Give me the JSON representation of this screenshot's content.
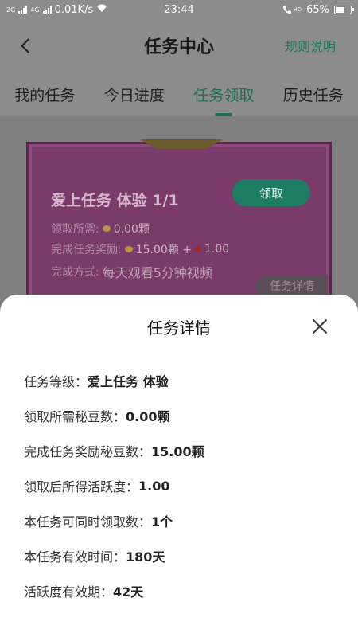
{
  "status_bar": {
    "network_left": "2G",
    "network_right": "4G",
    "speed": "0.01K/s",
    "time": "23:44",
    "call_badge": "HD",
    "battery": "65%",
    "battery_level": 0.65
  },
  "header": {
    "title": "任务中心",
    "rules_link": "规则说明"
  },
  "tabs": [
    {
      "label": "我的任务",
      "active": false
    },
    {
      "label": "今日进度",
      "active": false
    },
    {
      "label": "任务领取",
      "active": true
    },
    {
      "label": "历史任务",
      "active": false
    }
  ],
  "task_card": {
    "title": "爱上任务 体验 1/1",
    "claim_button": "领取",
    "required_label": "领取所需:",
    "required_value": "0.00颗",
    "reward_label": "完成任务奖励:",
    "reward_beans": "15.00颗 +",
    "reward_activity": "1.00",
    "method_label": "完成方式:",
    "method_value": "每天观看5分钟视频",
    "detail_tag": "任务详情"
  },
  "sheet": {
    "title": "任务详情",
    "rows": [
      {
        "label": "任务等级：",
        "value": "爱上任务 体验"
      },
      {
        "label": "领取所需秘豆数：",
        "value": "0.00颗"
      },
      {
        "label": "完成任务奖励秘豆数：",
        "value": "15.00颗"
      },
      {
        "label": "领取后所得活跃度：",
        "value": "1.00"
      },
      {
        "label": "本任务可同时领取数：",
        "value": "1个"
      },
      {
        "label": "本任务有效时间：",
        "value": "180天"
      },
      {
        "label": "活跃度有效期：",
        "value": "42天"
      }
    ]
  },
  "colors": {
    "accent": "#1c6e55",
    "button": "#1d7d62",
    "card": "#7a3a6a"
  }
}
